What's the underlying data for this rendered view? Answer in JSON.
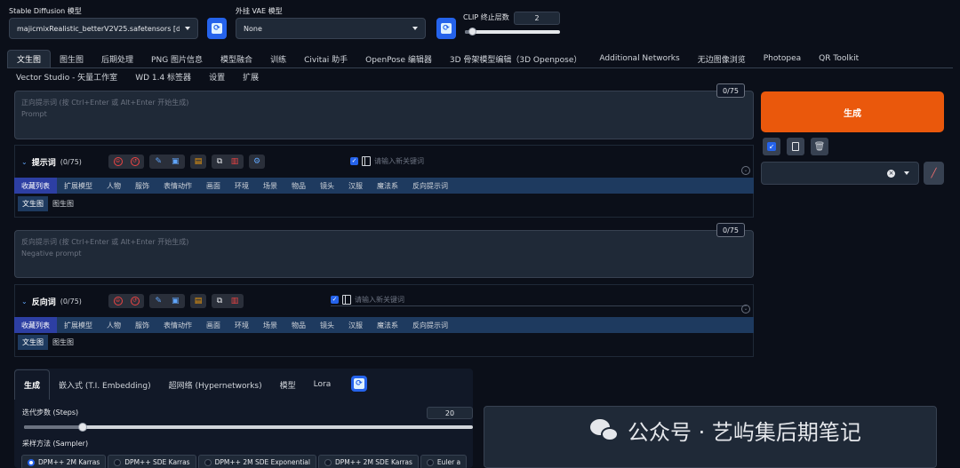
{
  "top": {
    "sd_model_label": "Stable Diffusion 模型",
    "sd_model_value": "majicmixRealistic_betterV2V25.safetensors [d7e",
    "vae_label": "外挂 VAE 模型",
    "vae_value": "None",
    "clip_label": "CLIP 终止层数",
    "clip_value": "2",
    "clip_fraction": 0.08
  },
  "main_tabs_row1": [
    "文生图",
    "图生图",
    "后期处理",
    "PNG 图片信息",
    "模型融合",
    "训练",
    "Civitai 助手",
    "OpenPose 编辑器",
    "3D 骨架模型编辑（3D Openpose）",
    "Additional Networks",
    "无边图像浏览",
    "Photopea",
    "QR Toolkit"
  ],
  "main_tabs_row2": [
    "Vector Studio - 矢量工作室",
    "WD 1.4 标签器",
    "设置",
    "扩展"
  ],
  "prompt": {
    "counter": "0/75",
    "placeholder1": "正向提示词 (按 Ctrl+Enter 或 Alt+Enter 开始生成)",
    "placeholder2": "Prompt"
  },
  "negative": {
    "counter": "0/75",
    "placeholder1": "反向提示词 (按 Ctrl+Enter 或 Alt+Enter 开始生成)",
    "placeholder2": "Negative prompt"
  },
  "helper_pos": {
    "title": "提示词",
    "count": "(0/75)",
    "keyword_placeholder": "请输入新关键词",
    "categories": [
      "收藏列表",
      "扩展模型",
      "人物",
      "服饰",
      "表情动作",
      "画面",
      "环境",
      "场景",
      "物品",
      "镜头",
      "汉服",
      "魔法系",
      "反向提示词"
    ],
    "subtabs": [
      "文生图",
      "图生图"
    ]
  },
  "helper_neg": {
    "title": "反向词",
    "count": "(0/75)",
    "keyword_placeholder": "请输入新关键词",
    "categories": [
      "收藏列表",
      "扩展模型",
      "人物",
      "服饰",
      "表情动作",
      "画面",
      "环境",
      "场景",
      "物品",
      "镜头",
      "汉服",
      "魔法系",
      "反向提示词"
    ],
    "subtabs": [
      "文生图",
      "图生图"
    ]
  },
  "generate_label": "生成",
  "bottom_tabs": [
    "生成",
    "嵌入式 (T.I. Embedding)",
    "超网络 (Hypernetworks)",
    "模型",
    "Lora"
  ],
  "steps": {
    "label": "迭代步数 (Steps)",
    "value": "20",
    "fraction": 0.13
  },
  "sampler": {
    "label": "采样方法 (Sampler)",
    "options": [
      "DPM++ 2M Karras",
      "DPM++ SDE Karras",
      "DPM++ 2M SDE Exponential",
      "DPM++ 2M SDE Karras",
      "Euler a"
    ],
    "selected": "DPM++ 2M Karras"
  },
  "watermark": "公众号 · 艺屿集后期笔记",
  "colors": {
    "accent": "#ea580c",
    "blue": "#2563eb",
    "bg": "#0b0f19"
  }
}
